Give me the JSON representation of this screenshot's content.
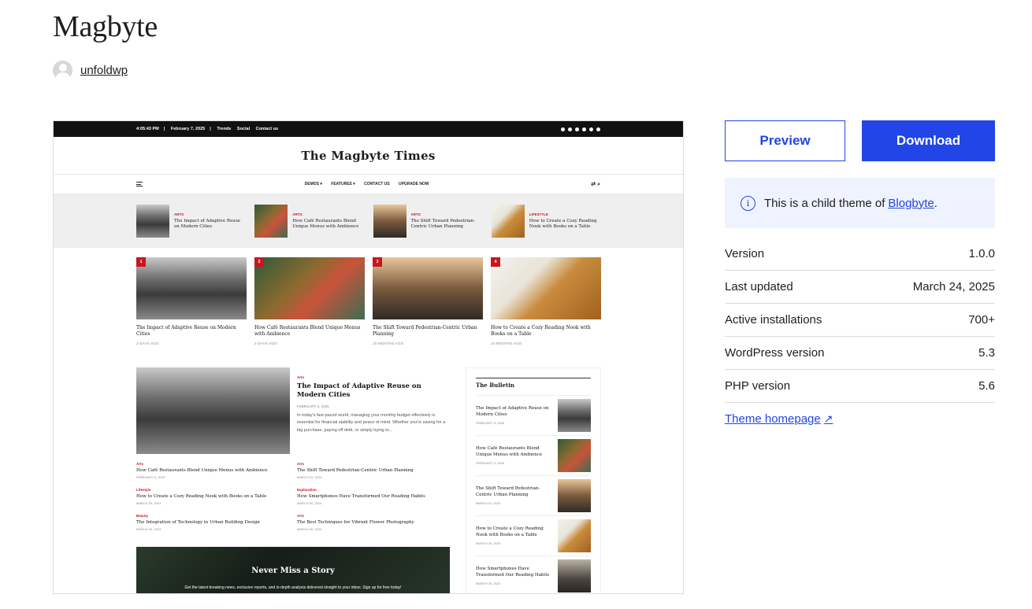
{
  "theme": {
    "title": "Magbyte",
    "author": "unfoldwp"
  },
  "screenshot": {
    "topbar": {
      "time": "4:05:43 PM",
      "date": "February 7, 2025",
      "links": [
        "Trends",
        "Social",
        "Contact us"
      ]
    },
    "masthead": "The Magbyte Times",
    "nav": [
      "DEMOS ▾",
      "FEATURES ▾",
      "CONTACT US",
      "UPGRADE NOW"
    ],
    "ticker": [
      {
        "cat": "ARTS",
        "title": "The Impact of Adaptive Reuse on Modern Cities"
      },
      {
        "cat": "ARTS",
        "title": "How Café Restaurants Blend Unique Menus with Ambience"
      },
      {
        "cat": "ARTS",
        "title": "The Shift Toward Pedestrian-Centric Urban Planning"
      },
      {
        "cat": "LIFESTYLE",
        "title": "How to Create a Cozy Reading Nook with Books on a Table"
      }
    ],
    "cards": [
      {
        "num": "1",
        "title": "The Impact of Adaptive Reuse on Modern Cities",
        "date": "2 DAYS AGO"
      },
      {
        "num": "2",
        "title": "How Café Restaurants Blend Unique Menus with Ambience",
        "date": "2 DAYS AGO"
      },
      {
        "num": "3",
        "title": "The Shift Toward Pedestrian-Centric Urban Planning",
        "date": "10 MONTHS AGO"
      },
      {
        "num": "4",
        "title": "How to Create a Cozy Reading Nook with Books on a Table",
        "date": "10 MONTHS AGO"
      }
    ],
    "featured": {
      "cat": "Arts",
      "title": "The Impact of Adaptive Reuse on Modern Cities",
      "date": "FEBRUARY 5, 2025",
      "excerpt": "In today's fast-paced world, managing your monthly budget effectively is essential for financial stability and peace of mind. Whether you're saving for a big purchase, paying off debt, or simply trying to..."
    },
    "minis": [
      {
        "cat": "Arts",
        "title": "How Café Restaurants Blend Unique Menus with Ambience",
        "date": "FEBRUARY 5, 2025"
      },
      {
        "cat": "Arts",
        "title": "The Shift Toward Pedestrian-Centric Urban Planning",
        "date": "MARCH 31, 2024"
      },
      {
        "cat": "Lifestyle",
        "title": "How to Create a Cozy Reading Nook with Books on a Table",
        "date": "MARCH 30, 2024"
      },
      {
        "cat": "Exploration",
        "title": "How Smartphones Have Transformed Our Reading Habits",
        "date": "MARCH 30, 2024"
      },
      {
        "cat": "Beauty",
        "title": "The Integration of Technology in Urban Building Design",
        "date": "MARCH 30, 2024"
      },
      {
        "cat": "Arts",
        "title": "The Best Techniques for Vibrant Flower Photography",
        "date": "MARCH 30, 2024"
      }
    ],
    "bulletin": {
      "heading": "The Bulletin",
      "items": [
        {
          "title": "The Impact of Adaptive Reuse on Modern Cities",
          "date": "FEBRUARY 5, 2025"
        },
        {
          "title": "How Café Restaurants Blend Unique Menus with Ambience",
          "date": "FEBRUARY 5, 2025"
        },
        {
          "title": "The Shift Toward Pedestrian-Centric Urban Planning",
          "date": "MARCH 31, 2024"
        },
        {
          "title": "How to Create a Cozy Reading Nook with Books on a Table",
          "date": "MARCH 30, 2024"
        },
        {
          "title": "How Smartphones Have Transformed Our Reading Habits",
          "date": "MARCH 30, 2024"
        }
      ]
    },
    "newsletter": {
      "title": "Never Miss a Story",
      "subtitle": "Get the latest breaking news, exclusive reports, and in-depth analysis delivered straight to your inbox. Sign up for free today!"
    }
  },
  "actions": {
    "preview": "Preview",
    "download": "Download"
  },
  "notice": {
    "text": "This is a child theme of",
    "link": "Blogbyte",
    "suffix": "."
  },
  "meta": [
    {
      "label": "Version",
      "value": "1.0.0"
    },
    {
      "label": "Last updated",
      "value": "March 24, 2025"
    },
    {
      "label": "Active installations",
      "value": "700+"
    },
    {
      "label": "WordPress version",
      "value": "5.3"
    },
    {
      "label": "PHP version",
      "value": "5.6"
    }
  ],
  "homepage": {
    "label": "Theme homepage",
    "icon": "external-arrow-icon"
  },
  "colors": {
    "accent": "#2145e6",
    "notice_bg": "#eff2ff",
    "red": "#c9151e"
  }
}
